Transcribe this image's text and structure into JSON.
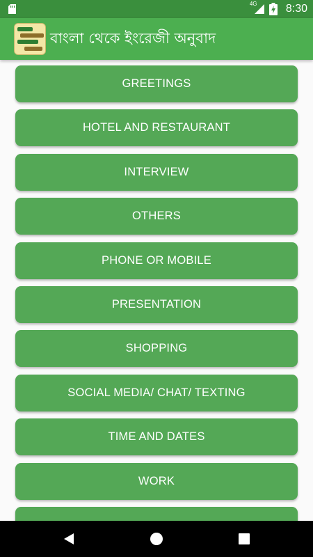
{
  "status": {
    "time": "8:30",
    "network": "4G",
    "icons": [
      "sd-card-icon",
      "signal-icon",
      "battery-charging-icon"
    ]
  },
  "app_bar": {
    "title": "বাংলা থেকে ইংরেজী অনুবাদ",
    "logo_icon": "app-logo-icon"
  },
  "categories": [
    "GREETINGS",
    "HOTEL AND RESTAURANT",
    "INTERVIEW",
    "OTHERS",
    "PHONE OR MOBILE",
    "PRESENTATION",
    "SHOPPING",
    "SOCIAL MEDIA/ CHAT/ TEXTING",
    "TIME AND DATES",
    "WORK",
    ""
  ],
  "colors": {
    "status_bar": "#3a8f3d",
    "app_bar": "#4caf50",
    "button": "#54a856",
    "background": "#fafafa"
  },
  "nav": {
    "icons": [
      "back-icon",
      "home-icon",
      "recents-icon"
    ]
  }
}
